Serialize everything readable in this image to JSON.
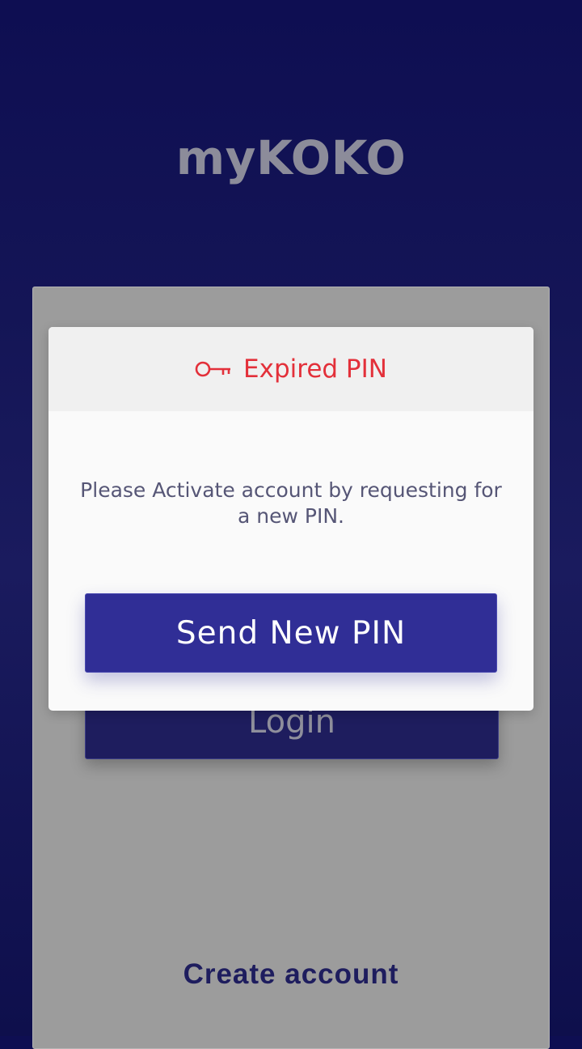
{
  "app": {
    "title": "myKOKO"
  },
  "login_screen": {
    "login_label": "Login",
    "create_account_label": "Create account"
  },
  "dialog": {
    "icon": "key-icon",
    "title": "Expired PIN",
    "message": "Please Activate account by requesting for a new PIN.",
    "send_button_label": "Send New PIN"
  },
  "colors": {
    "background": "#13145a",
    "accent": "#302e96",
    "error": "#e3303a",
    "card": "#9c9c9c"
  }
}
